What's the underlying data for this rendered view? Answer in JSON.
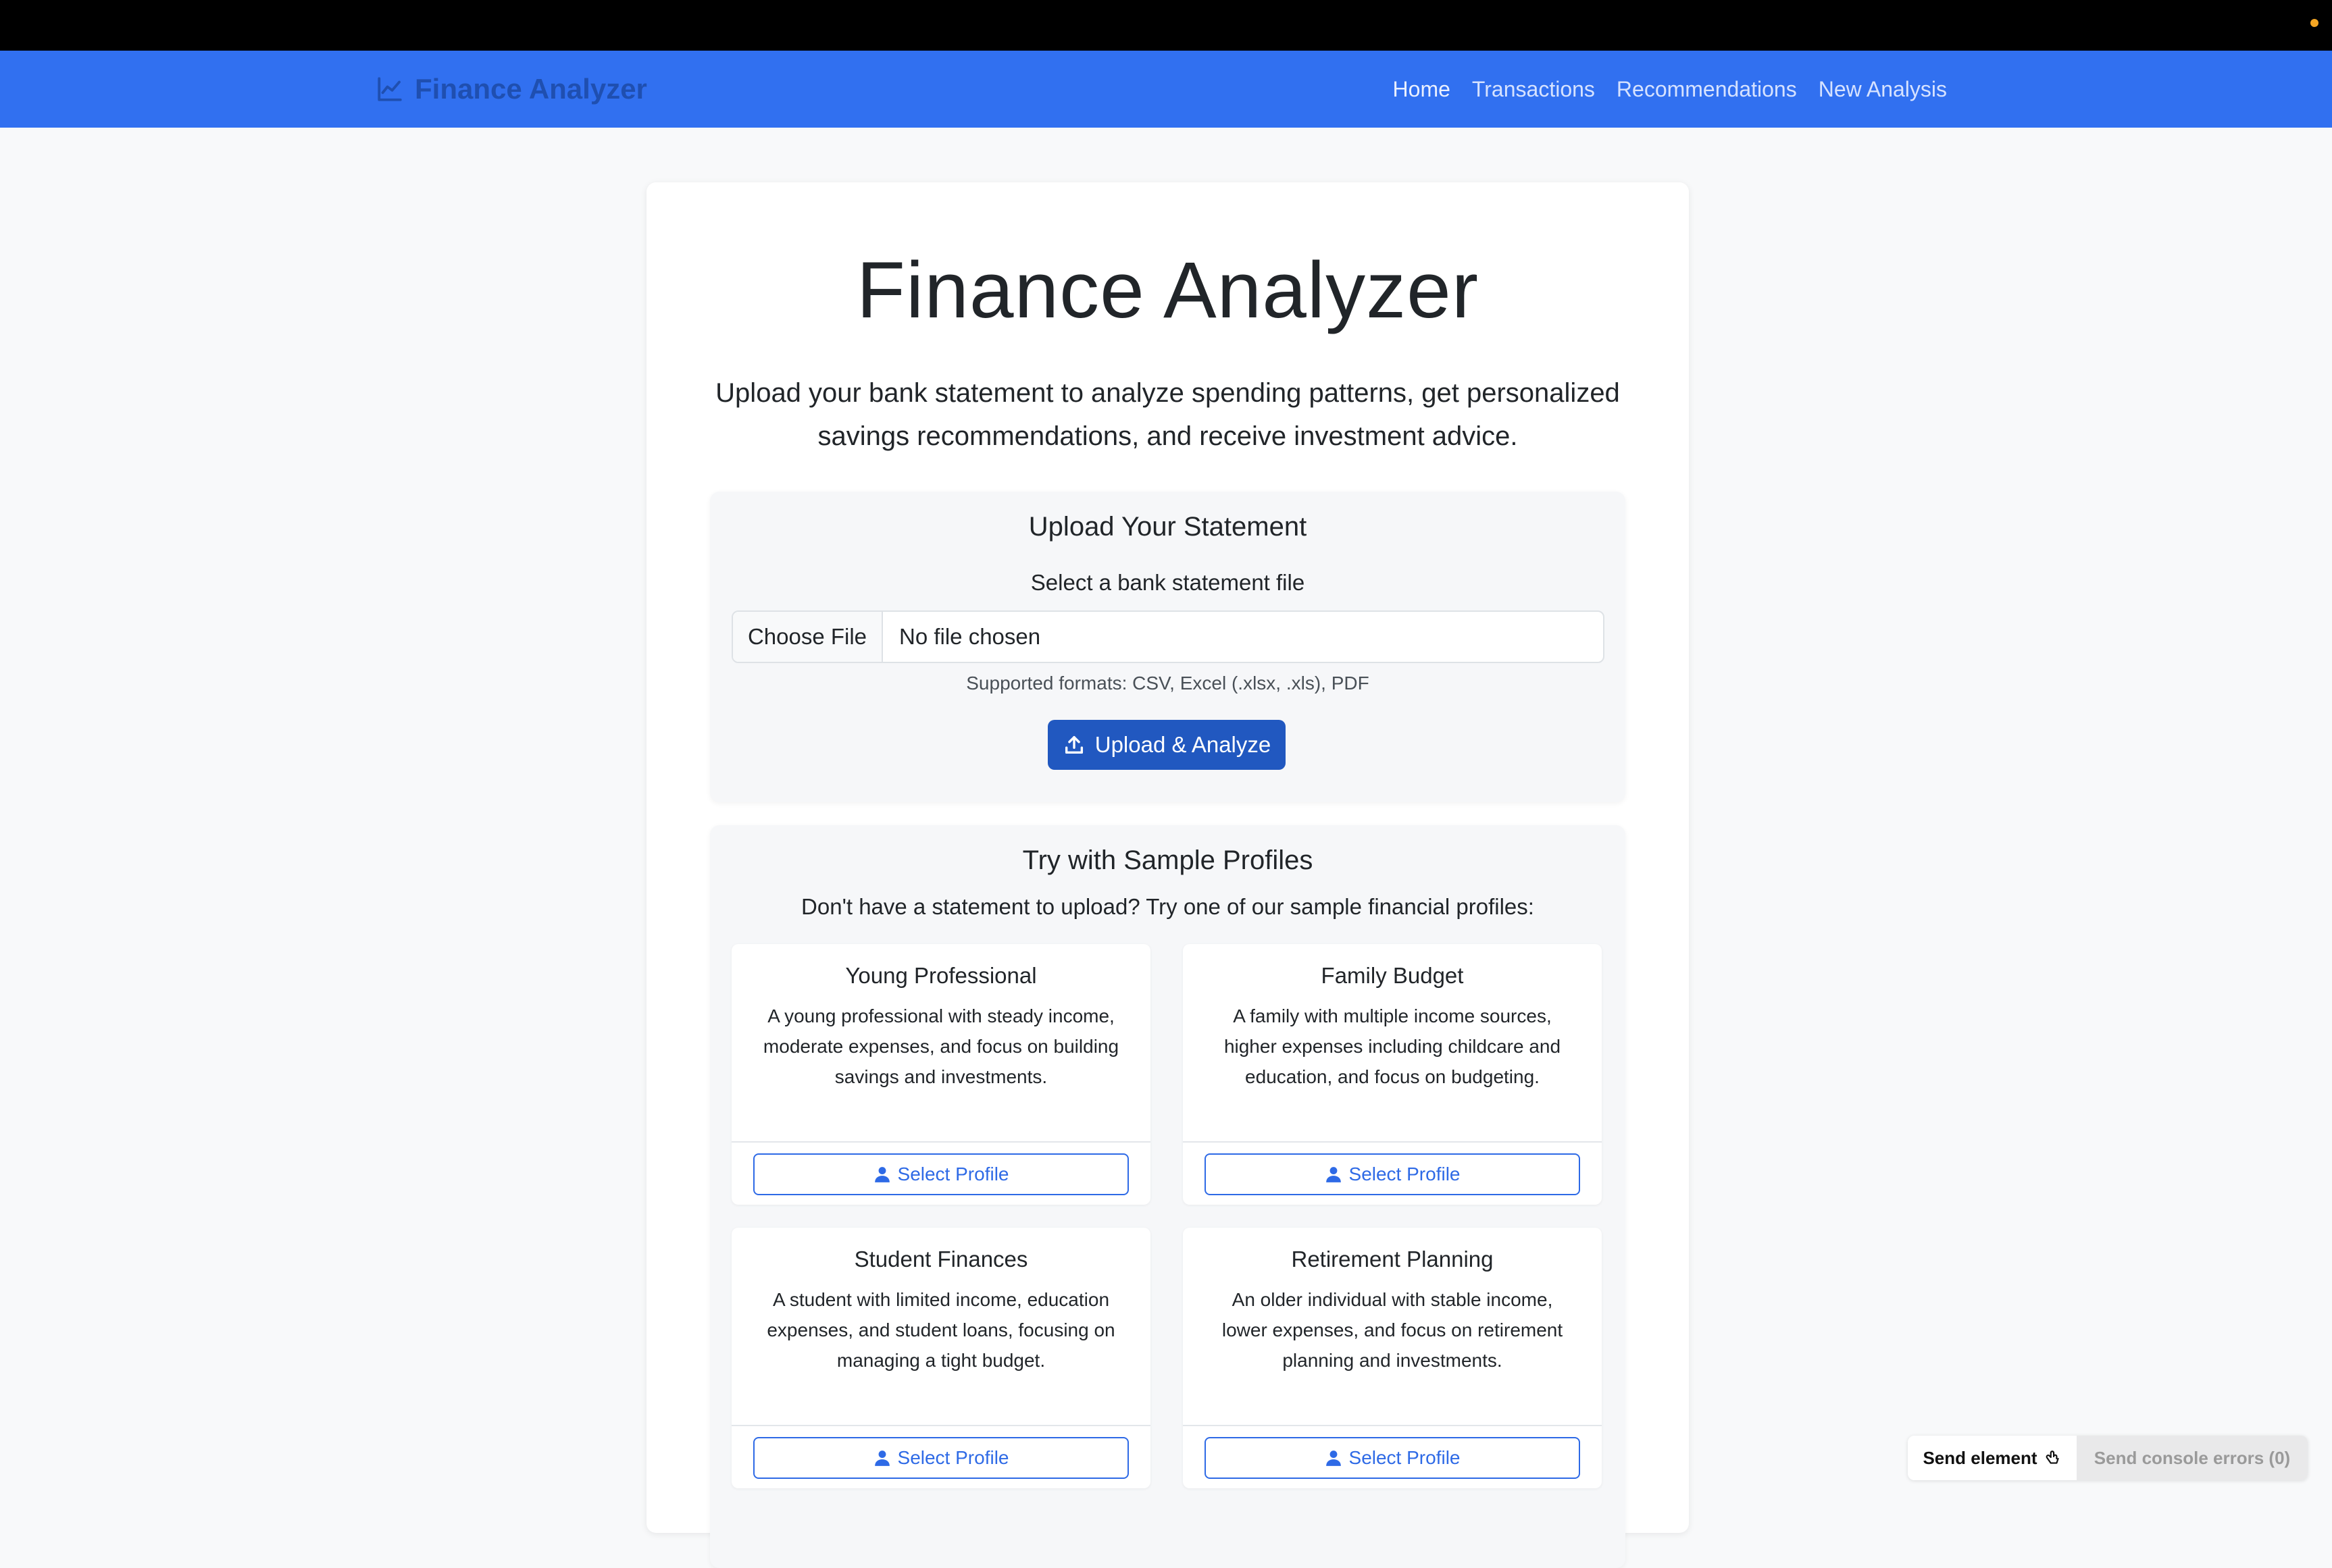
{
  "navbar": {
    "brand": "Finance Analyzer",
    "links": [
      "Home",
      "Transactions",
      "Recommendations",
      "New Analysis"
    ]
  },
  "hero": {
    "title": "Finance Analyzer",
    "subtitle": "Upload your bank statement to analyze spending patterns, get personalized savings recommendations, and receive investment advice."
  },
  "upload": {
    "title": "Upload Your Statement",
    "file_label": "Select a bank statement file",
    "choose_label": "Choose File",
    "file_status": "No file chosen",
    "formats": "Supported formats: CSV, Excel (.xlsx, .xls), PDF",
    "button": "Upload & Analyze"
  },
  "samples": {
    "title": "Try with Sample Profiles",
    "intro": "Don't have a statement to upload? Try one of our sample financial profiles:",
    "profiles": [
      {
        "title": "Young Professional",
        "description": "A young professional with steady income, moderate expenses, and focus on building savings and investments.",
        "button": "Select Profile"
      },
      {
        "title": "Family Budget",
        "description": "A family with multiple income sources, higher expenses including childcare and education, and focus on budgeting.",
        "button": "Select Profile"
      },
      {
        "title": "Student Finances",
        "description": "A student with limited income, education expenses, and student loans, focusing on managing a tight budget.",
        "button": "Select Profile"
      },
      {
        "title": "Retirement Planning",
        "description": "An older individual with stable income, lower expenses, and focus on retirement planning and investments.",
        "button": "Select Profile"
      }
    ]
  },
  "devtools": {
    "send_element": "Send element",
    "send_errors": "Send console errors (0)"
  },
  "colors": {
    "navbar": "#3170f0",
    "primary_button": "#2158c0",
    "outline_button": "#2e6ae6"
  }
}
